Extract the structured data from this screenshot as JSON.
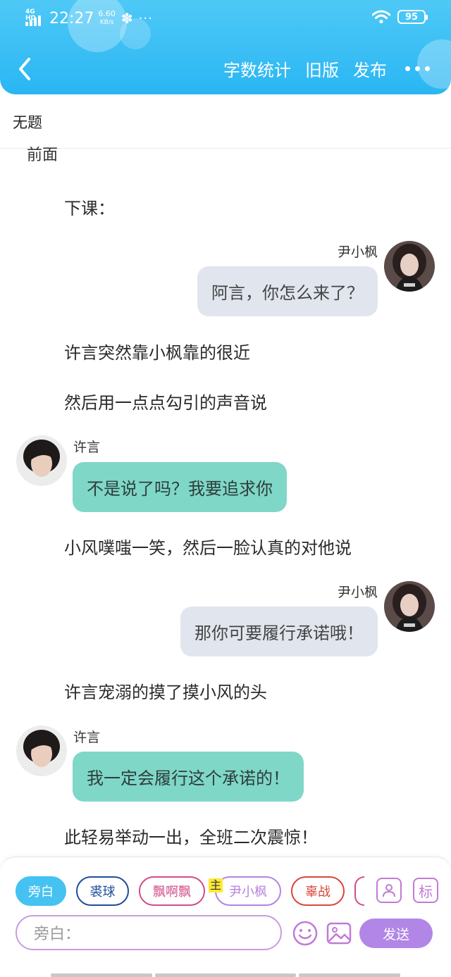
{
  "status_bar": {
    "network": "4G HD",
    "time": "22:27",
    "speed_value": "6.60",
    "speed_unit": "KB/s",
    "more": "···",
    "battery": "95"
  },
  "nav": {
    "word_count": "字数统计",
    "old_version": "旧版",
    "publish": "发布"
  },
  "doc": {
    "title": "无题",
    "cut_line": "前面"
  },
  "story": [
    {
      "type": "narration",
      "text": "下课："
    },
    {
      "type": "dialog",
      "side": "right",
      "speaker": "尹小枫",
      "text": "阿言，你怎么来了？"
    },
    {
      "type": "narration",
      "text": "许言突然靠小枫靠的很近"
    },
    {
      "type": "narration",
      "text": "然后用一点点勾引的声音说"
    },
    {
      "type": "dialog",
      "side": "left",
      "speaker": "许言",
      "text": "不是说了吗？我要追求你"
    },
    {
      "type": "narration",
      "text": "小风噗嗤一笑，然后一脸认真的对他说"
    },
    {
      "type": "dialog",
      "side": "right",
      "speaker": "尹小枫",
      "text": "那你可要履行承诺哦！"
    },
    {
      "type": "narration",
      "text": "许言宠溺的摸了摸小风的头"
    },
    {
      "type": "dialog",
      "side": "left",
      "speaker": "许言",
      "text": "我一定会履行这个承诺的！"
    },
    {
      "type": "narration",
      "text": "此轻易举动一出，全班二次震惊！"
    }
  ],
  "composer": {
    "roles": [
      {
        "label": "旁白",
        "color": "#45c2f2",
        "selected": true
      },
      {
        "label": "裘球",
        "color": "#1f4e9c",
        "selected": false
      },
      {
        "label": "飘啊飘",
        "color": "#d14d8a",
        "selected": false
      },
      {
        "label": "尹小枫",
        "color": "#b783dd",
        "selected": false
      },
      {
        "label": "辜战",
        "color": "#d9473e",
        "selected": false
      }
    ],
    "main_badge": "主",
    "tag_icon": "标",
    "input_placeholder": "旁白：",
    "send_label": "发送"
  },
  "colors": {
    "header": "#2ab6f3",
    "bubble_right": "#e1e6ee",
    "bubble_left": "#7fd7c8",
    "send": "#b286e6"
  }
}
